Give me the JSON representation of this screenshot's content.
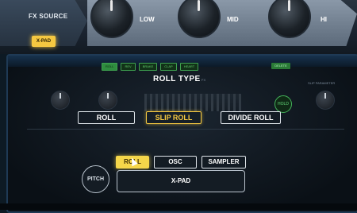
{
  "hardware": {
    "fx_source_label": "FX SOURCE",
    "xpad_button_label": "X-PAD",
    "knobs": [
      {
        "label": "LOW"
      },
      {
        "label": "MID"
      },
      {
        "label": "HI"
      }
    ]
  },
  "screen": {
    "title": "ROLL TYPE",
    "top_tabs": [
      {
        "label": "ROLL",
        "active": true
      },
      {
        "label": "REV",
        "active": false
      },
      {
        "label": "BRAKE",
        "active": false
      },
      {
        "label": "CLAP",
        "active": false
      },
      {
        "label": "HEART",
        "active": false
      }
    ],
    "delete_label": "DELETE",
    "hold_label": "HOLD",
    "small_caption_left": "FX",
    "small_caption_right": "SLIP PARAMETER",
    "roll_types": [
      {
        "label": "ROLL",
        "active": false
      },
      {
        "label": "SLIP ROLL",
        "active": true
      },
      {
        "label": "DIVIDE ROLL",
        "active": false
      }
    ],
    "bottom_tabs": [
      {
        "label": "ROLL",
        "active": true
      },
      {
        "label": "OSC",
        "active": false
      },
      {
        "label": "SAMPLER",
        "active": false
      }
    ],
    "pitch_label": "PITCH",
    "xpad_label": "X-PAD"
  },
  "colors": {
    "accent_yellow": "#f5c841",
    "accent_green": "#3ea24f",
    "screen_bg": "#0a1016"
  }
}
